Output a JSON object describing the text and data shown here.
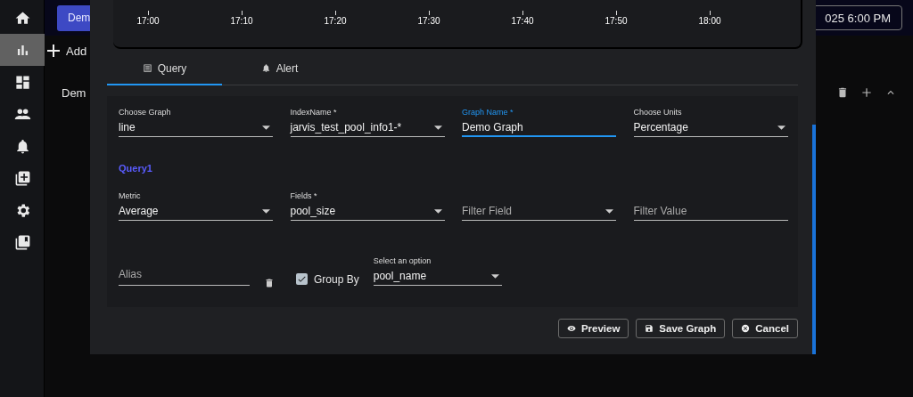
{
  "sidebar": {
    "items": [
      {
        "kind": "home",
        "selected": false
      },
      {
        "kind": "chart",
        "selected": true
      },
      {
        "kind": "dashboard",
        "selected": false
      },
      {
        "kind": "people",
        "selected": false
      },
      {
        "kind": "bell",
        "selected": false
      },
      {
        "kind": "add-copy",
        "selected": false
      },
      {
        "kind": "gear",
        "selected": false
      },
      {
        "kind": "bookmarks",
        "selected": false
      }
    ]
  },
  "top_bar": {
    "tab_button": "Dem",
    "datetime": "025 6:00 PM"
  },
  "page": {
    "add_link": "Add",
    "panel_title": "Dem"
  },
  "dialog": {
    "chart": {
      "x_ticks": [
        "17:00",
        "17:10",
        "17:20",
        "17:30",
        "17:40",
        "17:50",
        "18:00"
      ]
    },
    "tabs": [
      {
        "label": "Query",
        "kind": "list",
        "selected": true
      },
      {
        "label": "Alert",
        "kind": "bell",
        "selected": false
      }
    ],
    "fields": [
      {
        "label": "Choose Graph",
        "value": "line",
        "kind": "select",
        "focused": false
      },
      {
        "label": "IndexName *",
        "value": "jarvis_test_pool_info1-*",
        "kind": "select",
        "focused": false
      },
      {
        "label": "Graph Name *",
        "value": "Demo Graph",
        "kind": "text",
        "focused": true
      },
      {
        "label": "Choose Units",
        "value": "Percentage",
        "kind": "select",
        "focused": false
      }
    ],
    "query_title": "Query1",
    "query_fields": [
      {
        "label": "Metric",
        "value": "Average",
        "kind": "select",
        "focused": false
      },
      {
        "label": "Fields *",
        "value": "pool_size",
        "kind": "select",
        "focused": false
      },
      {
        "placeholder": "Filter Field",
        "kind": "select",
        "focused": false
      },
      {
        "placeholder": "Filter Value",
        "kind": "text",
        "focused": false
      }
    ],
    "alias": {
      "placeholder": "Alias"
    },
    "group_by": {
      "label": "Group By",
      "checked": true
    },
    "group_select": {
      "label": "Select an option",
      "value": "pool_name"
    },
    "buttons": [
      {
        "label": "Preview",
        "kind": "eye"
      },
      {
        "label": "Save Graph",
        "kind": "save"
      },
      {
        "label": "Cancel",
        "kind": "cancel"
      }
    ]
  }
}
